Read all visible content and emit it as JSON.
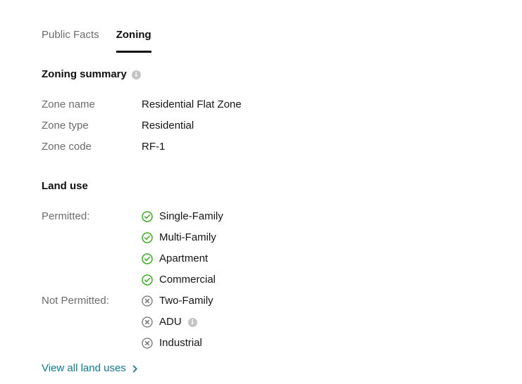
{
  "tabs": [
    {
      "label": "Public Facts",
      "active": false
    },
    {
      "label": "Zoning",
      "active": true
    }
  ],
  "zoning_summary": {
    "heading": "Zoning summary",
    "info_icon": "info-icon",
    "rows": [
      {
        "label": "Zone name",
        "value": "Residential Flat Zone"
      },
      {
        "label": "Zone type",
        "value": "Residential"
      },
      {
        "label": "Zone code",
        "value": "RF-1"
      }
    ]
  },
  "land_use": {
    "heading": "Land use",
    "permitted": {
      "label": "Permitted:",
      "icon": "check-circle-icon",
      "items": [
        {
          "text": "Single-Family"
        },
        {
          "text": "Multi-Family"
        },
        {
          "text": "Apartment"
        },
        {
          "text": "Commercial"
        }
      ]
    },
    "not_permitted": {
      "label": "Not Permitted:",
      "icon": "x-circle-icon",
      "items": [
        {
          "text": "Two-Family"
        },
        {
          "text": "ADU",
          "info_icon": "info-icon"
        },
        {
          "text": "Industrial"
        }
      ]
    },
    "view_all_link": {
      "label": "View all land uses",
      "icon": "chevron-right-icon"
    }
  },
  "colors": {
    "allowed_green": "#3aaf1e",
    "denied_gray": "#717171",
    "link_teal": "#12798f",
    "label_gray": "#6b6b6b",
    "text_black": "#141414",
    "info_gray": "#c4c4c4",
    "tab_underline": "#121212"
  }
}
